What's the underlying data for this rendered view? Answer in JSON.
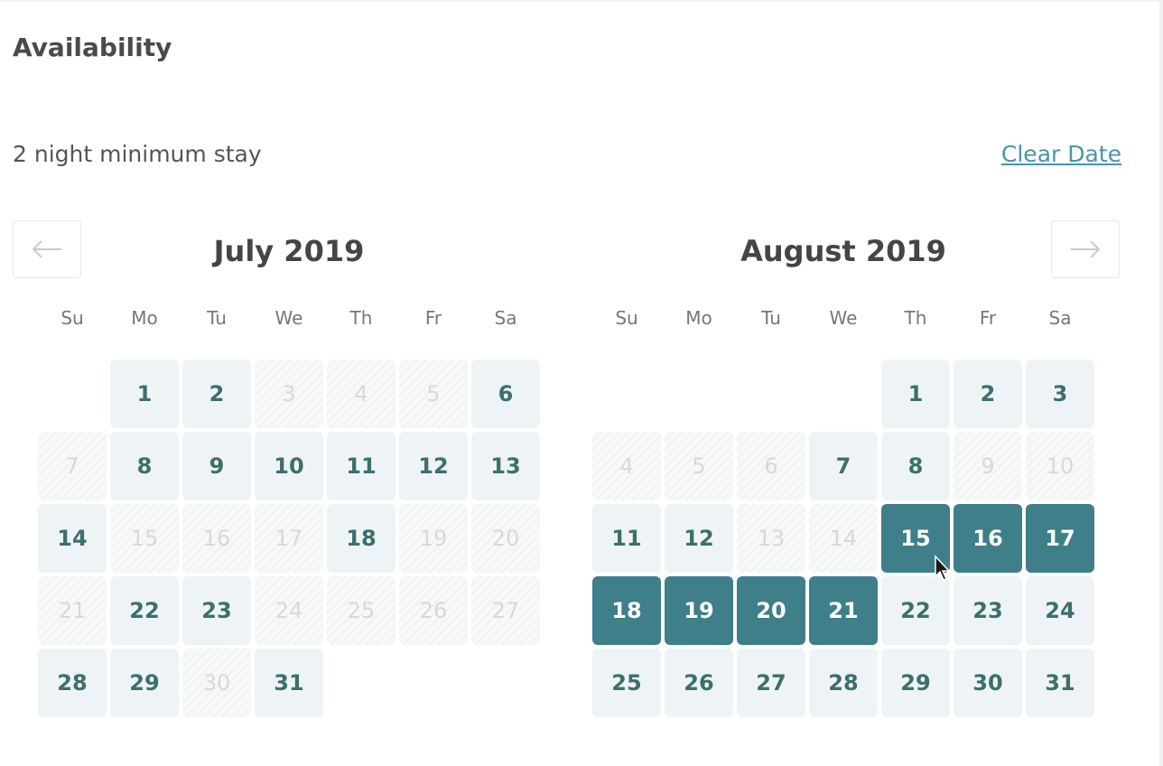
{
  "header": {
    "title": "Availability",
    "min_stay": "2 night minimum stay",
    "clear_label": "Clear Date"
  },
  "nav": {
    "prev_icon": "arrow-left-icon",
    "next_icon": "arrow-right-icon"
  },
  "colors": {
    "accent": "#3e7f89",
    "link": "#4a94a5",
    "available_bg": "#eef4f6"
  },
  "weekdays": [
    "Su",
    "Mo",
    "Tu",
    "We",
    "Th",
    "Fr",
    "Sa"
  ],
  "months": [
    {
      "title": "July 2019",
      "days": [
        {
          "d": ""
        },
        {
          "d": "1",
          "s": "available"
        },
        {
          "d": "2",
          "s": "available"
        },
        {
          "d": "3",
          "s": "blocked"
        },
        {
          "d": "4",
          "s": "blocked"
        },
        {
          "d": "5",
          "s": "blocked"
        },
        {
          "d": "6",
          "s": "available"
        },
        {
          "d": "7",
          "s": "blocked"
        },
        {
          "d": "8",
          "s": "available"
        },
        {
          "d": "9",
          "s": "available"
        },
        {
          "d": "10",
          "s": "available"
        },
        {
          "d": "11",
          "s": "available"
        },
        {
          "d": "12",
          "s": "available"
        },
        {
          "d": "13",
          "s": "available"
        },
        {
          "d": "14",
          "s": "available"
        },
        {
          "d": "15",
          "s": "blocked"
        },
        {
          "d": "16",
          "s": "blocked"
        },
        {
          "d": "17",
          "s": "blocked"
        },
        {
          "d": "18",
          "s": "available"
        },
        {
          "d": "19",
          "s": "blocked"
        },
        {
          "d": "20",
          "s": "blocked"
        },
        {
          "d": "21",
          "s": "blocked"
        },
        {
          "d": "22",
          "s": "available"
        },
        {
          "d": "23",
          "s": "available"
        },
        {
          "d": "24",
          "s": "blocked"
        },
        {
          "d": "25",
          "s": "blocked"
        },
        {
          "d": "26",
          "s": "blocked"
        },
        {
          "d": "27",
          "s": "blocked"
        },
        {
          "d": "28",
          "s": "available"
        },
        {
          "d": "29",
          "s": "available"
        },
        {
          "d": "30",
          "s": "blocked"
        },
        {
          "d": "31",
          "s": "available"
        }
      ]
    },
    {
      "title": "August 2019",
      "days": [
        {
          "d": ""
        },
        {
          "d": ""
        },
        {
          "d": ""
        },
        {
          "d": ""
        },
        {
          "d": "1",
          "s": "available"
        },
        {
          "d": "2",
          "s": "available"
        },
        {
          "d": "3",
          "s": "available"
        },
        {
          "d": "4",
          "s": "blocked"
        },
        {
          "d": "5",
          "s": "blocked"
        },
        {
          "d": "6",
          "s": "blocked"
        },
        {
          "d": "7",
          "s": "available"
        },
        {
          "d": "8",
          "s": "available"
        },
        {
          "d": "9",
          "s": "blocked"
        },
        {
          "d": "10",
          "s": "blocked"
        },
        {
          "d": "11",
          "s": "available"
        },
        {
          "d": "12",
          "s": "available"
        },
        {
          "d": "13",
          "s": "blocked"
        },
        {
          "d": "14",
          "s": "blocked"
        },
        {
          "d": "15",
          "s": "selected"
        },
        {
          "d": "16",
          "s": "selected"
        },
        {
          "d": "17",
          "s": "selected"
        },
        {
          "d": "18",
          "s": "selected"
        },
        {
          "d": "19",
          "s": "selected"
        },
        {
          "d": "20",
          "s": "selected"
        },
        {
          "d": "21",
          "s": "selected"
        },
        {
          "d": "22",
          "s": "available"
        },
        {
          "d": "23",
          "s": "available"
        },
        {
          "d": "24",
          "s": "available"
        },
        {
          "d": "25",
          "s": "available"
        },
        {
          "d": "26",
          "s": "available"
        },
        {
          "d": "27",
          "s": "available"
        },
        {
          "d": "28",
          "s": "available"
        },
        {
          "d": "29",
          "s": "available"
        },
        {
          "d": "30",
          "s": "available"
        },
        {
          "d": "31",
          "s": "available"
        }
      ]
    }
  ]
}
